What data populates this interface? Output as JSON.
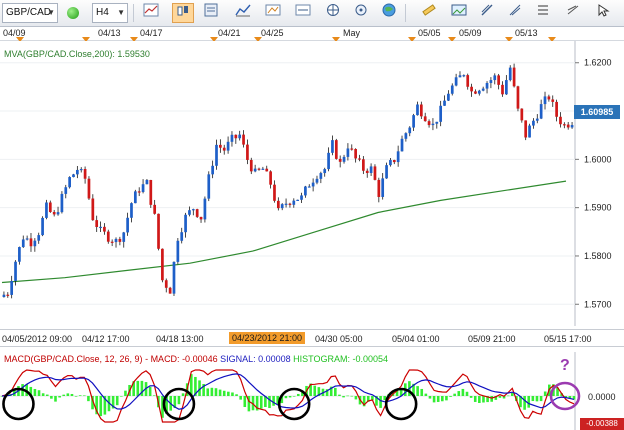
{
  "toolbar": {
    "symbol": "GBP/CAD",
    "timeframe": "H4",
    "icons": [
      "status-dot-icon",
      "bar-chart-icon",
      "candlestick-icon",
      "properties-icon",
      "indicators-icon",
      "drawing-icon",
      "zoom-icon",
      "cursor-icon",
      "world-icon",
      "ruler-icon",
      "screenshot-icon",
      "trendline-icon",
      "list-icon",
      "fibonacci-icon",
      "more-icon"
    ]
  },
  "date_header": {
    "labels": [
      "04/09",
      "04/13",
      "04/17",
      "04/21",
      "04/25",
      "May",
      "05/05",
      "05/09",
      "05/13"
    ]
  },
  "overlay": {
    "label": "MVA(GBP/CAD.Close,200): 1.59530"
  },
  "price_axis": {
    "ticks": [
      "1.6200",
      "1.6100",
      "1.6000",
      "1.5900",
      "1.5800",
      "1.5700"
    ],
    "current_price": "1.60985"
  },
  "time_axis": {
    "labels": [
      "04/05/2012 09:00",
      "04/12 17:00",
      "04/18 13:00",
      "04/23/2012 21:00",
      "04/30 05:00",
      "05/04 01:00",
      "05/09 21:00",
      "05/15 17:00"
    ],
    "highlighted_index": 3
  },
  "macd": {
    "title": "MACD(GBP/CAD.Close, 12, 26, 9)",
    "macd_value": "MACD: -0.00046",
    "signal_value": "SIGNAL: 0.00008",
    "histogram_value": "HISTOGRAM: -0.00054",
    "axis_zero": "0.0000",
    "axis_min": "-0.00388",
    "question": "?"
  },
  "colors": {
    "bull_candle": "#1e5fc8",
    "bear_candle": "#d01818",
    "ma_line": "#2f8a2f",
    "macd_line": "#cc0000",
    "signal_line": "#1010c0",
    "histogram": "#33ee33",
    "circle_black": "#000000",
    "circle_purple": "#9b3bb0",
    "price_box": "#2a73b8",
    "highlight": "#f29b2b"
  },
  "chart_data": {
    "type": "candlestick",
    "instrument": "GBP/CAD",
    "timeframe": "H4",
    "ylim": [
      1.5655,
      1.6245
    ],
    "y_ticks": [
      1.62,
      1.61,
      1.6,
      1.59,
      1.58,
      1.57
    ],
    "price_path": [
      1.5715,
      1.5725,
      1.579,
      1.584,
      1.583,
      1.585,
      1.59,
      1.588,
      1.592,
      1.596,
      1.598,
      1.596,
      1.588,
      1.585,
      1.584,
      1.583,
      1.585,
      1.591,
      1.594,
      1.595,
      1.588,
      1.575,
      1.573,
      1.584,
      1.588,
      1.59,
      1.588,
      1.596,
      1.603,
      1.602,
      1.604,
      1.605,
      1.6,
      1.597,
      1.598,
      1.595,
      1.589,
      1.591,
      1.592,
      1.592,
      1.595,
      1.597,
      1.598,
      1.603,
      1.599,
      1.603,
      1.6,
      1.598,
      1.598,
      1.593,
      1.598,
      1.6,
      1.604,
      1.607,
      1.611,
      1.609,
      1.607,
      1.61,
      1.614,
      1.616,
      1.618,
      1.614,
      1.615,
      1.616,
      1.617,
      1.614,
      1.619,
      1.61,
      1.605,
      1.608,
      1.611,
      1.613,
      1.609,
      1.607,
      1.608
    ],
    "ma200": [
      1.5745,
      1.5755,
      1.577,
      1.5785,
      1.581,
      1.585,
      1.589,
      1.5915,
      1.5935,
      1.5955
    ],
    "macd_circles": 5
  }
}
